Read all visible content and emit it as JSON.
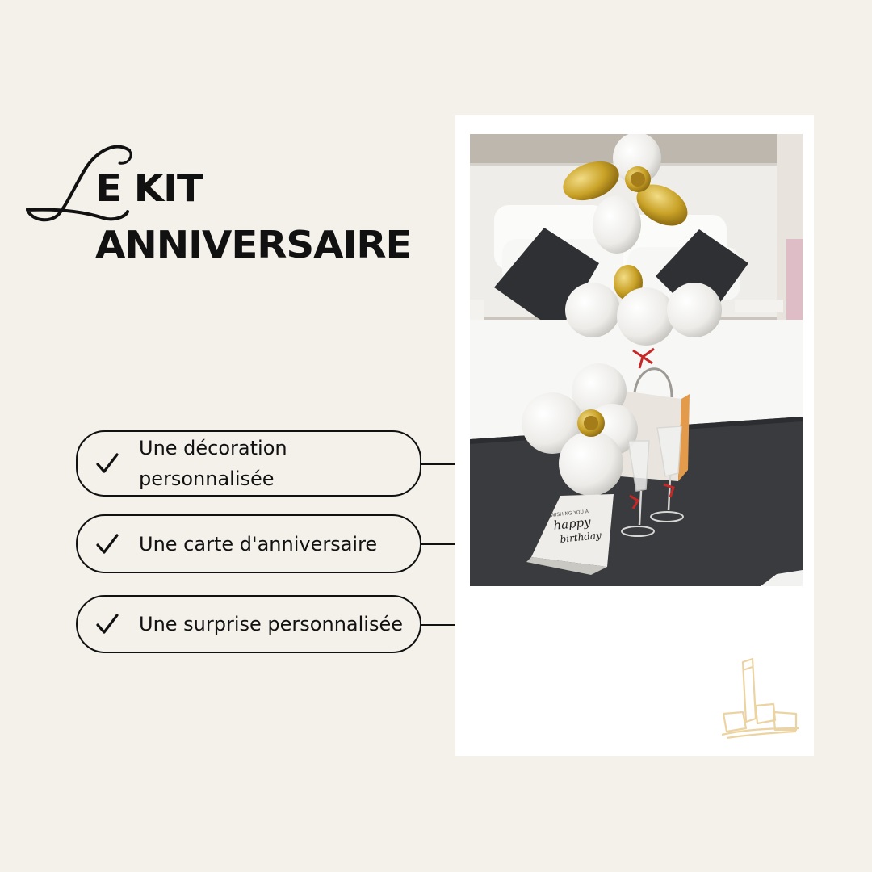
{
  "title": {
    "letter": "L",
    "line1": "E KIT",
    "line2": "ANNIVERSAIRE"
  },
  "features": [
    {
      "line1": "Une décoration",
      "line2": "personnalisée"
    },
    {
      "line1": "Une carte d'anniversaire",
      "line2": ""
    },
    {
      "line1": "Une surprise personnalisée",
      "line2": ""
    }
  ],
  "photo": {
    "card_text_small": "WISHING YOU A",
    "card_text_1": "happy",
    "card_text_2": "birthday"
  },
  "colors": {
    "background": "#f4f0ea",
    "ink": "#111111",
    "gold": "#c9a227",
    "logo": "#ecd3a2"
  }
}
